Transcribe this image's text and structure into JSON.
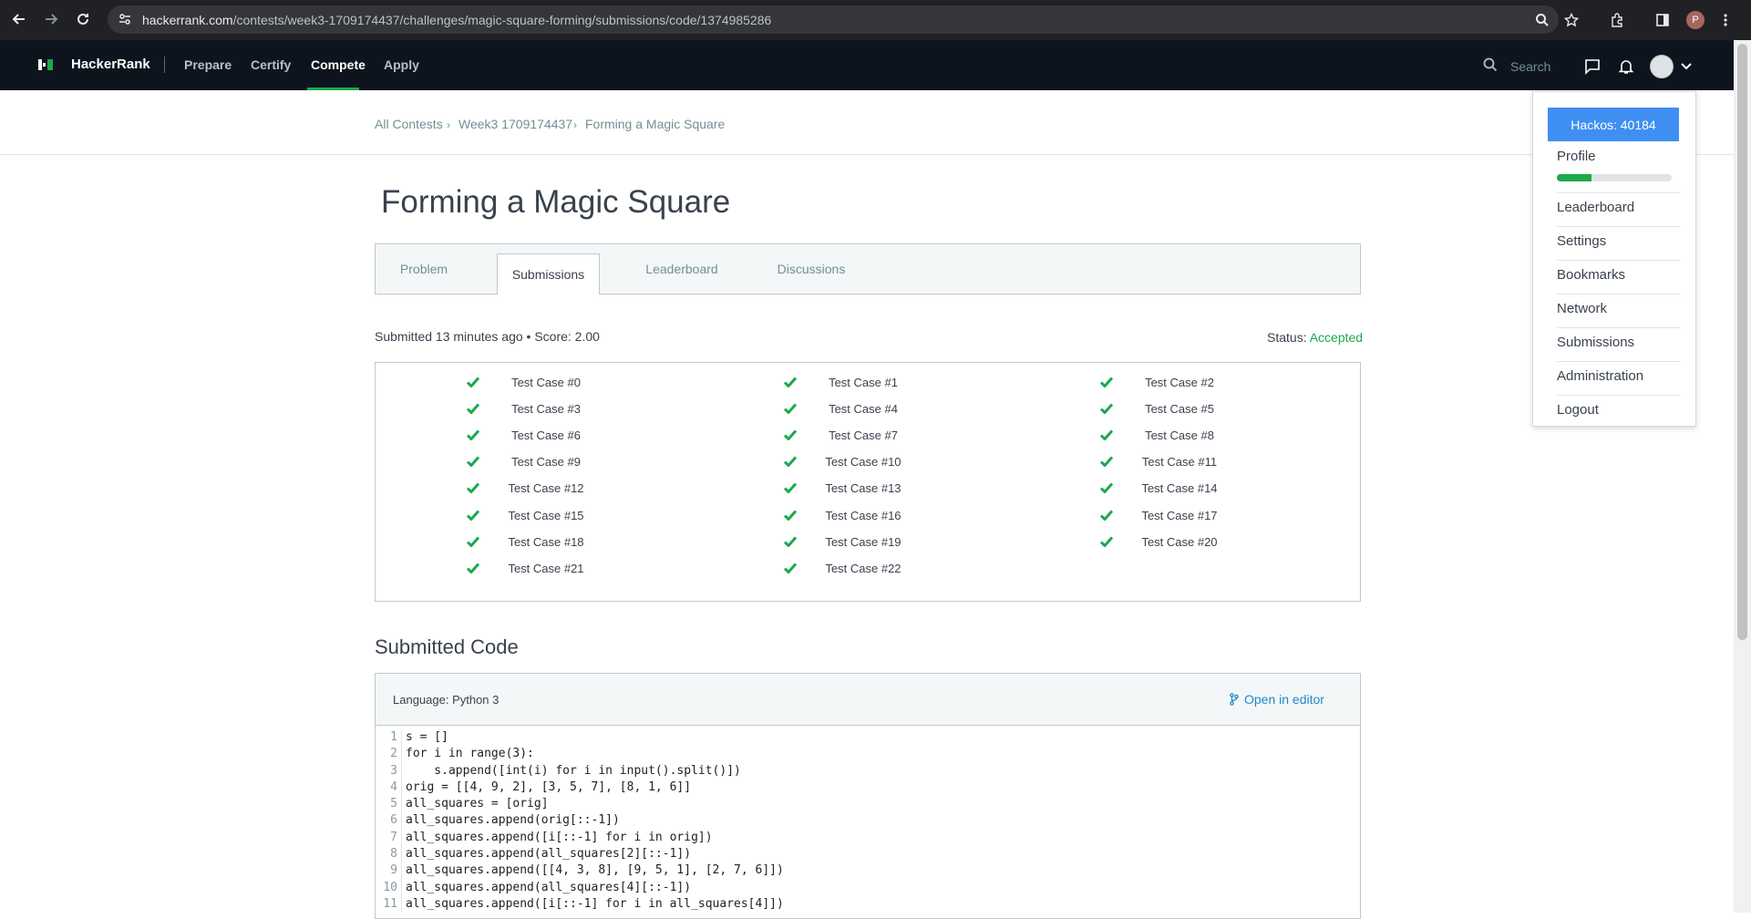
{
  "browser": {
    "url_host": "hackerrank.com",
    "url_path": "/contests/week3-1709174437/challenges/magic-square-forming/submissions/code/1374985286",
    "profile_initial": "P"
  },
  "nav": {
    "brand": "HackerRank",
    "links": [
      "Prepare",
      "Certify",
      "Compete",
      "Apply"
    ],
    "active": "Compete",
    "search_placeholder": "Search"
  },
  "breadcrumb": [
    "All Contests",
    "Week3 1709174437",
    "Forming a Magic Square"
  ],
  "title": "Forming a Magic Square",
  "tabs": [
    "Problem",
    "Submissions",
    "Leaderboard",
    "Discussions"
  ],
  "active_tab": "Submissions",
  "submission": {
    "info": "Submitted 13 minutes ago • Score: 2.00",
    "status_label": "Status:",
    "status_value": "Accepted"
  },
  "test_cases": [
    "Test Case #0",
    "Test Case #1",
    "Test Case #2",
    "Test Case #3",
    "Test Case #4",
    "Test Case #5",
    "Test Case #6",
    "Test Case #7",
    "Test Case #8",
    "Test Case #9",
    "Test Case #10",
    "Test Case #11",
    "Test Case #12",
    "Test Case #13",
    "Test Case #14",
    "Test Case #15",
    "Test Case #16",
    "Test Case #17",
    "Test Case #18",
    "Test Case #19",
    "Test Case #20",
    "Test Case #21",
    "Test Case #22"
  ],
  "code_section": {
    "title": "Submitted Code",
    "language": "Language: Python 3",
    "open_editor": "Open in editor",
    "lines": [
      "s = []",
      "for i in range(3):",
      "    s.append([int(i) for i in input().split()])",
      "orig = [[4, 9, 2], [3, 5, 7], [8, 1, 6]]",
      "all_squares = [orig]",
      "all_squares.append(orig[::-1])",
      "all_squares.append([i[::-1] for i in orig])",
      "all_squares.append(all_squares[2][::-1])",
      "all_squares.append([[4, 3, 8], [9, 5, 1], [2, 7, 6]])",
      "all_squares.append(all_squares[4][::-1])",
      "all_squares.append([i[::-1] for i in all_squares[4]])"
    ]
  },
  "dropdown": {
    "hackos": "Hackos: 40184",
    "profile": "Profile",
    "profile_progress": 0.3,
    "items": [
      "Leaderboard",
      "Settings",
      "Bookmarks",
      "Network",
      "Submissions",
      "Administration",
      "Logout"
    ]
  },
  "colors": {
    "accent_green": "#1ba94c",
    "nav_bg": "#0e141e",
    "link_blue": "#1f8acb",
    "hackos_blue": "#3f8ff3"
  }
}
